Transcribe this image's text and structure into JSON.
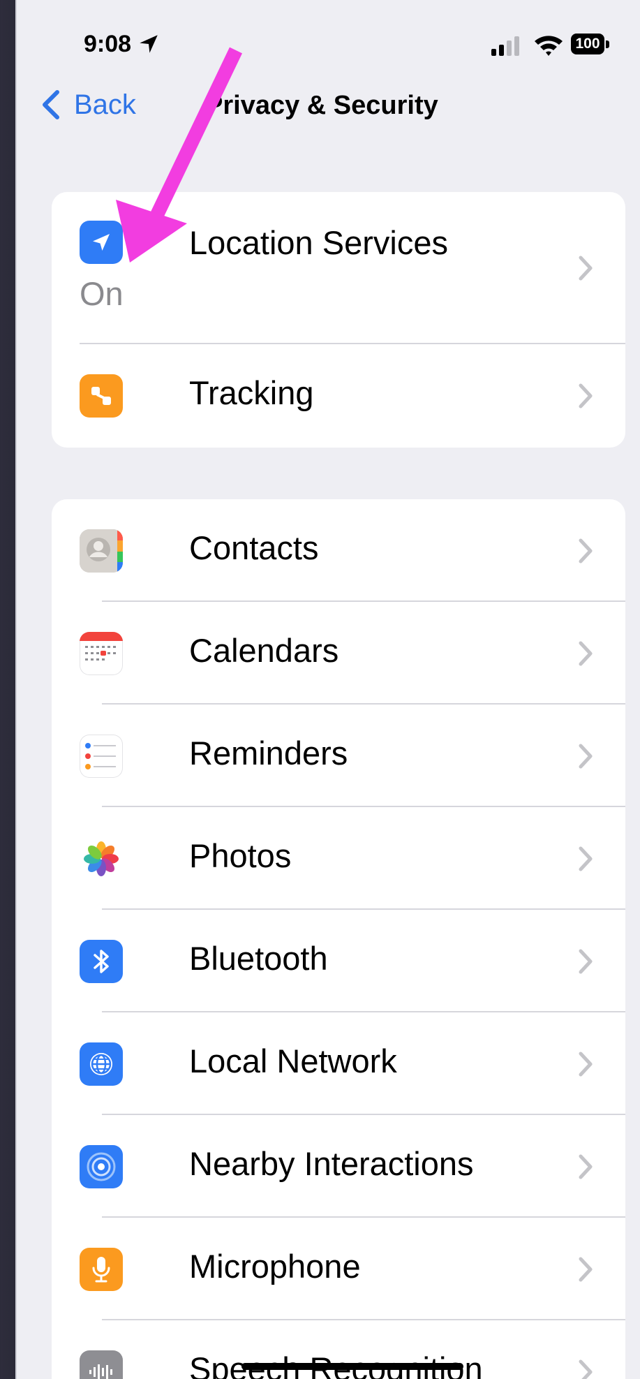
{
  "status_bar": {
    "time": "9:08",
    "battery": "100"
  },
  "nav": {
    "back_label": "Back",
    "title": "Privacy & Security"
  },
  "group1": [
    {
      "label": "Location Services",
      "value": "On",
      "icon": "location-arrow-icon",
      "color": "#2f7cf6"
    },
    {
      "label": "Tracking",
      "icon": "tracking-icon",
      "color": "#fb9a1f"
    }
  ],
  "group2": [
    {
      "label": "Contacts",
      "icon": "contacts-icon",
      "color": "#c9c6c1"
    },
    {
      "label": "Calendars",
      "icon": "calendar-icon",
      "color": "#ffffff"
    },
    {
      "label": "Reminders",
      "icon": "reminders-icon",
      "color": "#ffffff"
    },
    {
      "label": "Photos",
      "icon": "photos-icon",
      "color": "#ffffff"
    },
    {
      "label": "Bluetooth",
      "icon": "bluetooth-icon",
      "color": "#2f7cf6"
    },
    {
      "label": "Local Network",
      "icon": "globe-icon",
      "color": "#2f7cf6"
    },
    {
      "label": "Nearby Interactions",
      "icon": "nearby-icon",
      "color": "#2f7cf6"
    },
    {
      "label": "Microphone",
      "icon": "microphone-icon",
      "color": "#fb9a1f"
    },
    {
      "label": "Speech Recognition",
      "icon": "waveform-icon",
      "color": "#8e8e93"
    }
  ],
  "annotation_color": "#f23de0"
}
